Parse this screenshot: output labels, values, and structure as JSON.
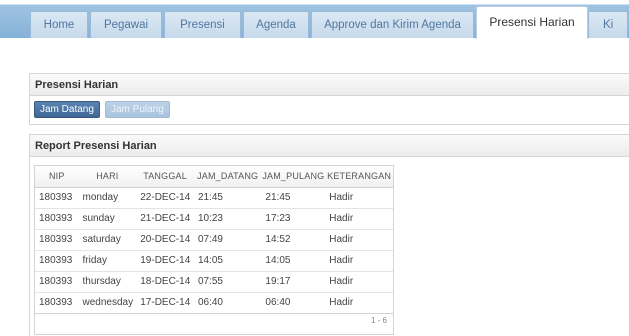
{
  "nav": {
    "tabs": [
      {
        "label": "Home"
      },
      {
        "label": "Pegawai"
      },
      {
        "label": "Presensi"
      },
      {
        "label": "Agenda"
      },
      {
        "label": "Approve dan Kirim Agenda"
      },
      {
        "label": "Presensi Harian"
      },
      {
        "label": "Ki"
      }
    ],
    "active_tab": "Presensi Harian"
  },
  "presensi_panel": {
    "title": "Presensi Harian",
    "buttons": {
      "jam_datang": "Jam Datang",
      "jam_pulang": "Jam Pulang"
    }
  },
  "report": {
    "title": "Report Presensi Harian",
    "columns": [
      "NIP",
      "HARI",
      "TANGGAL",
      "JAM_DATANG",
      "JAM_PULANG",
      "KETERANGAN"
    ],
    "rows": [
      [
        "180393",
        "monday",
        "22-DEC-14",
        "21:45",
        "21:45",
        "Hadir"
      ],
      [
        "180393",
        "sunday",
        "21-DEC-14",
        "10:23",
        "17:23",
        "Hadir"
      ],
      [
        "180393",
        "saturday",
        "20-DEC-14",
        "07:49",
        "14:52",
        "Hadir"
      ],
      [
        "180393",
        "friday",
        "19-DEC-14",
        "14:05",
        "14:05",
        "Hadir"
      ],
      [
        "180393",
        "thursday",
        "18-DEC-14",
        "07:55",
        "19:17",
        "Hadir"
      ],
      [
        "180393",
        "wednesday",
        "17-DEC-14",
        "06:40",
        "06:40",
        "Hadir"
      ]
    ],
    "pagination": "1 - 6"
  }
}
